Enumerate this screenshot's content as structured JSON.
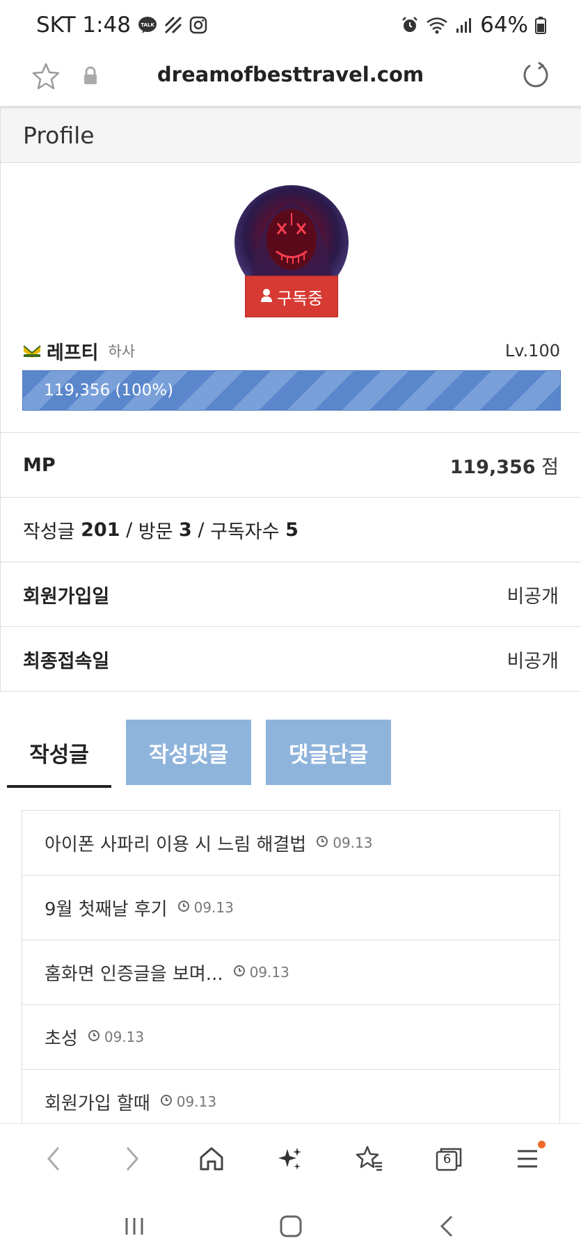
{
  "status_bar": {
    "carrier_time": "SKT 1:48",
    "battery": "64%"
  },
  "browser": {
    "url": "dreamofbesttravel.com",
    "tab_count": "6"
  },
  "profile": {
    "section_title": "Profile",
    "subscribe_label": "구독중",
    "name": "레프티",
    "rank": "하사",
    "level": "Lv.100",
    "exp_text": "119,356 (100%)",
    "exp_fraction": 1.0
  },
  "info": {
    "mp_label": "MP",
    "mp_value": "119,356",
    "mp_unit": "점",
    "posts_label": "작성글",
    "posts_count": "201",
    "visits_label": "방문",
    "visits_count": "3",
    "subscribers_label": "구독자수",
    "subscribers_count": "5",
    "joined_label": "회원가입일",
    "joined_value": "비공개",
    "last_login_label": "최종접속일",
    "last_login_value": "비공개"
  },
  "tabs": [
    {
      "label": "작성글",
      "active": true
    },
    {
      "label": "작성댓글",
      "active": false
    },
    {
      "label": "댓글단글",
      "active": false
    }
  ],
  "posts": [
    {
      "title": "아이폰 사파리 이용 시 느림 해결법",
      "date": "09.13"
    },
    {
      "title": "9월 첫째날 후기",
      "date": "09.13"
    },
    {
      "title": "홈화면 인증글을 보며...",
      "date": "09.13"
    },
    {
      "title": "초성",
      "date": "09.13"
    },
    {
      "title": "회원가입 할때",
      "date": "09.13"
    }
  ],
  "colors": {
    "subscribe_red": "#d63a32",
    "exp_blue": "#5a86cc",
    "tab_inactive_blue": "#8fb4dc",
    "notif_orange": "#f06a2a"
  }
}
